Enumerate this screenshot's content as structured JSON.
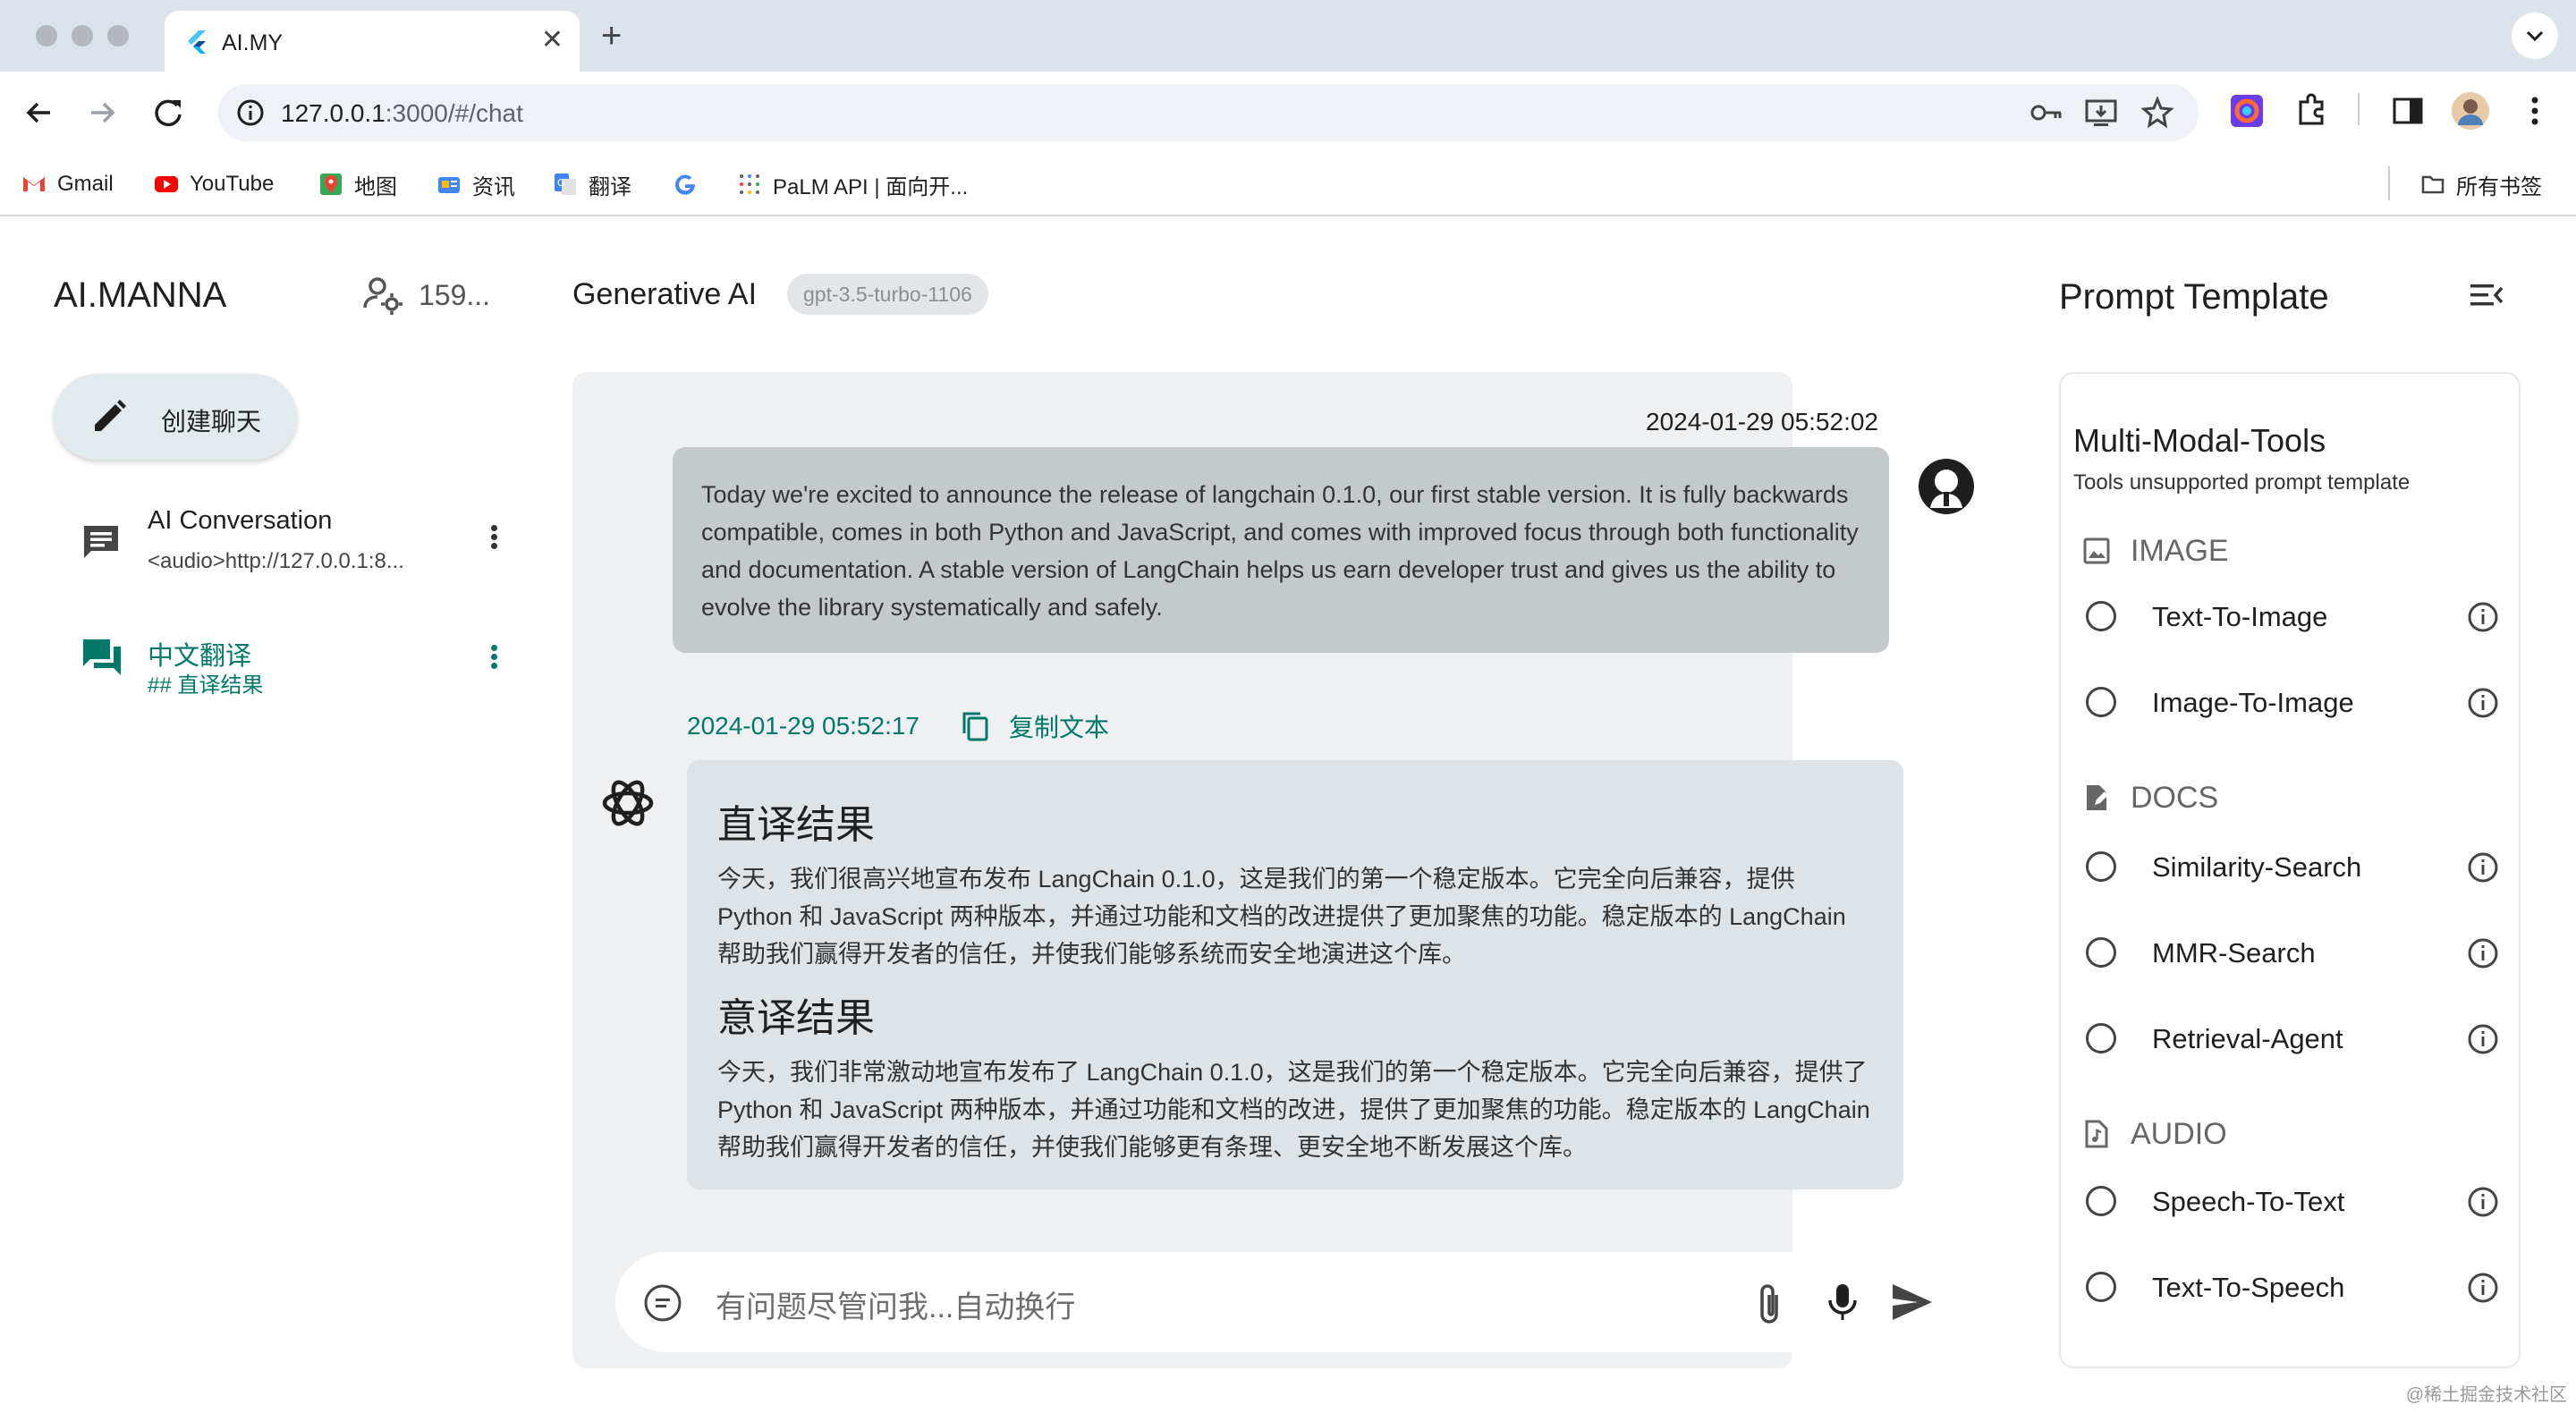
{
  "browser": {
    "tab_title": "AI.MY",
    "url_host": "127.0.0.1",
    "url_path": ":3000/#/chat",
    "bookmarks": [
      "Gmail",
      "YouTube",
      "地图",
      "资讯",
      "翻译",
      "",
      "PaLM API | 面向开..."
    ],
    "all_bookmarks": "所有书签"
  },
  "sidebar": {
    "brand": "AI.MANNA",
    "user_count": "159...",
    "new_chat_label": "创建聊天",
    "conversations": [
      {
        "title": "AI Conversation",
        "subtitle": "<audio>http://127.0.0.1:8..."
      },
      {
        "title": "中文翻译",
        "subtitle": "## 直译结果"
      }
    ]
  },
  "chat": {
    "title": "Generative AI",
    "model": "gpt-3.5-turbo-1106",
    "user_message": {
      "timestamp": "2024-01-29 05:52:02",
      "text": "Today we're excited to announce the release of langchain 0.1.0, our first stable version. It is fully backwards compatible, comes in both Python and JavaScript, and comes with improved focus through both functionality and documentation. A stable version of LangChain helps us earn developer trust and gives us the ability to evolve the library systematically and safely."
    },
    "ai_message": {
      "timestamp": "2024-01-29 05:52:17",
      "copy_label": "复制文本",
      "heading1": "直译结果",
      "para1": "今天，我们很高兴地宣布发布 LangChain 0.1.0，这是我们的第一个稳定版本。它完全向后兼容，提供 Python 和 JavaScript 两种版本，并通过功能和文档的改进提供了更加聚焦的功能。稳定版本的 LangChain 帮助我们赢得开发者的信任，并使我们能够系统而安全地演进这个库。",
      "heading2": "意译结果",
      "para2": "今天，我们非常激动地宣布发布了 LangChain 0.1.0，这是我们的第一个稳定版本。它完全向后兼容，提供了 Python 和 JavaScript 两种版本，并通过功能和文档的改进，提供了更加聚焦的功能。稳定版本的 LangChain 帮助我们赢得开发者的信任，并使我们能够更有条理、更安全地不断发展这个库。"
    },
    "input_placeholder": "有问题尽管问我...自动换行"
  },
  "prompt_panel": {
    "title": "Prompt Template",
    "heading": "Multi-Modal-Tools",
    "subtitle": "Tools unsupported prompt template",
    "sections": [
      {
        "name": "IMAGE",
        "items": [
          "Text-To-Image",
          "Image-To-Image"
        ]
      },
      {
        "name": "DOCS",
        "items": [
          "Similarity-Search",
          "MMR-Search",
          "Retrieval-Agent"
        ]
      },
      {
        "name": "AUDIO",
        "items": [
          "Speech-To-Text",
          "Text-To-Speech"
        ]
      }
    ]
  },
  "watermark": "@稀土掘金技术社区",
  "colors": {
    "accent": "#00796b",
    "user_bubble": "#c4c9cc",
    "ai_bubble": "#dde3e6"
  }
}
